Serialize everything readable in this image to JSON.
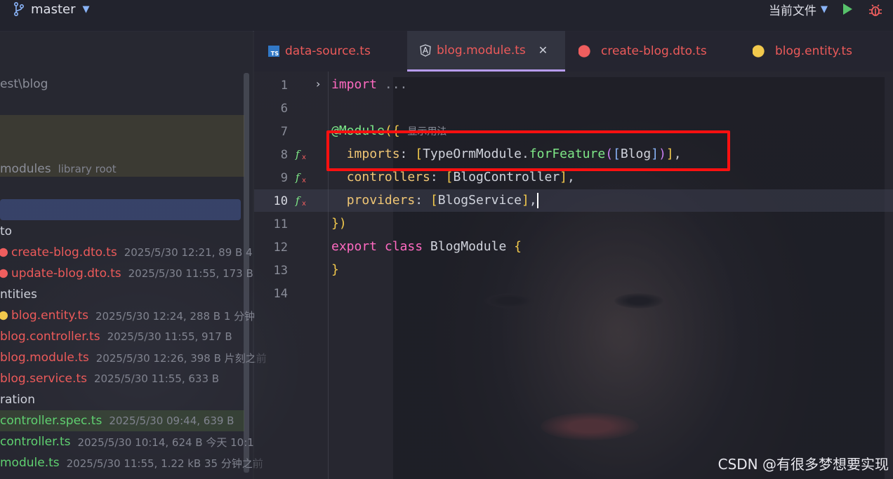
{
  "topbar": {
    "branch": "master",
    "config_label": "当前文件"
  },
  "sidebar": {
    "rows": [
      {
        "text": "est\\blog",
        "meta": "",
        "color": "gray"
      },
      {
        "text": "modules",
        "meta": "library root",
        "color": "gray"
      },
      {
        "text": "to",
        "meta": "",
        "color": "plain"
      },
      {
        "text": "create-blog.dto.ts",
        "meta": "2025/5/30 12:21, 89 B 4",
        "color": "red"
      },
      {
        "text": "update-blog.dto.ts",
        "meta": "2025/5/30 11:55, 173 B",
        "color": "red"
      },
      {
        "text": "ntities",
        "meta": "",
        "color": "plain"
      },
      {
        "text": "blog.entity.ts",
        "meta": "2025/5/30 12:24, 288 B 1 分钟",
        "color": "red"
      },
      {
        "text": "blog.controller.ts",
        "meta": "2025/5/30 11:55, 917 B",
        "color": "red"
      },
      {
        "text": "blog.module.ts",
        "meta": "2025/5/30 12:26, 398 B 片刻之前",
        "color": "red"
      },
      {
        "text": "blog.service.ts",
        "meta": "2025/5/30 11:55, 633 B",
        "color": "red"
      },
      {
        "text": "ration",
        "meta": "",
        "color": "plain"
      },
      {
        "text": "controller.spec.ts",
        "meta": "2025/5/30 09:44, 639 B",
        "color": "green"
      },
      {
        "text": "controller.ts",
        "meta": "2025/5/30 10:14, 624 B 今天 10:1",
        "color": "green"
      },
      {
        "text": "module.ts",
        "meta": "2025/5/30 11:55, 1.22 kB 35 分钟之前",
        "color": "green"
      }
    ]
  },
  "tabs": [
    {
      "label": "data-source.ts",
      "icon": "ts-icon"
    },
    {
      "label": "blog.module.ts",
      "icon": "angular-icon"
    },
    {
      "label": "create-blog.dto.ts",
      "icon": "nest-icon"
    },
    {
      "label": "blog.entity.ts",
      "icon": "nest-entity-icon"
    }
  ],
  "editor": {
    "line_numbers": [
      "1",
      "6",
      "7",
      "8",
      "9",
      "10",
      "11",
      "12",
      "13",
      "14"
    ],
    "lines": {
      "l1_kw": "import",
      "l1_rest": " ...",
      "l7_dec": "@Module",
      "l7_paren": "({",
      "l7_hint": "显示用法",
      "l8_prop": "imports",
      "l8_colon": ": ",
      "l8_ob": "[",
      "l8_cls": "TypeOrmModule",
      "l8_dot": ".",
      "l8_fn": "forFeature",
      "l8_p1": "(",
      "l8_ob2": "[",
      "l8_arg": "Blog",
      "l8_cb2": "]",
      "l8_p2": ")",
      "l8_cb": "]",
      "l8_comma": ",",
      "l9_prop": "controllers",
      "l9_colon": ": ",
      "l9_ob": "[",
      "l9_cls": "BlogController",
      "l9_cb": "]",
      "l9_comma": ",",
      "l10_prop": "providers",
      "l10_colon": ": ",
      "l10_ob": "[",
      "l10_cls": "BlogService",
      "l10_cb": "]",
      "l10_comma": ",",
      "l11": "})",
      "l12_kw1": "export",
      "l12_kw2": "class",
      "l12_name": "BlogModule",
      "l12_brace": "{",
      "l13": "}"
    }
  },
  "watermark": "CSDN @有很多梦想要实现",
  "colors": {
    "highlight": "#ff1010",
    "keyword": "#ff6ac1",
    "function": "#7ee787",
    "property": "#f0c674"
  }
}
